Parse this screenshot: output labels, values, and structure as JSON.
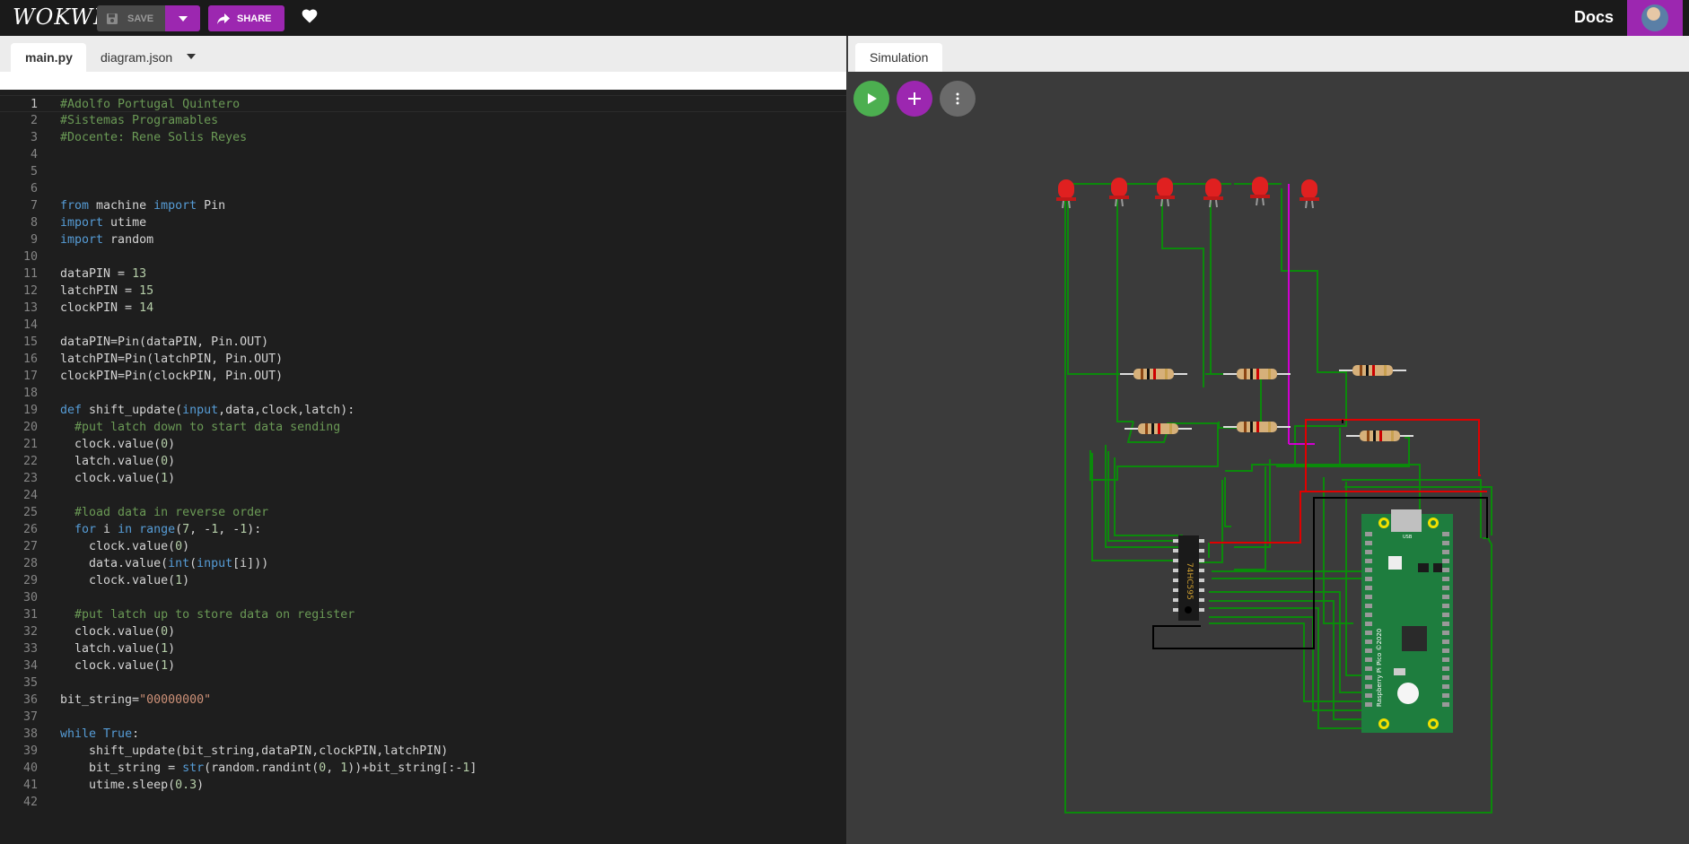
{
  "header": {
    "logo": "WOKWI",
    "save_label": "SAVE",
    "share_label": "SHARE",
    "docs_label": "Docs",
    "icons": [
      "save-icon",
      "chevron-down-icon",
      "share-arrow-icon",
      "heart-icon",
      "avatar"
    ]
  },
  "editor": {
    "tabs": [
      {
        "label": "main.py",
        "active": true
      },
      {
        "label": "diagram.json",
        "active": false
      }
    ],
    "line_numbers": [
      "1",
      "2",
      "3",
      "4",
      "5",
      "6",
      "7",
      "8",
      "9",
      "10",
      "11",
      "12",
      "13",
      "14",
      "15",
      "16",
      "17",
      "18",
      "19",
      "20",
      "21",
      "22",
      "23",
      "24",
      "25",
      "26",
      "27",
      "28",
      "29",
      "30",
      "31",
      "32",
      "33",
      "34",
      "35",
      "36",
      "37",
      "38",
      "39",
      "40",
      "41",
      "42"
    ],
    "code_lines": [
      "#Adolfo Portugal Quintero",
      "#Sistemas Programables",
      "#Docente: Rene Solis Reyes",
      "",
      "",
      "",
      "from machine import Pin",
      "import utime",
      "import random",
      "",
      "dataPIN = 13",
      "latchPIN = 15",
      "clockPIN = 14",
      "",
      "dataPIN=Pin(dataPIN, Pin.OUT)",
      "latchPIN=Pin(latchPIN, Pin.OUT)",
      "clockPIN=Pin(clockPIN, Pin.OUT)",
      "",
      "def shift_update(input,data,clock,latch):",
      "  #put latch down to start data sending",
      "  clock.value(0)",
      "  latch.value(0)",
      "  clock.value(1)",
      "",
      "  #load data in reverse order",
      "  for i in range(7, -1, -1):",
      "    clock.value(0)",
      "    data.value(int(input[i]))",
      "    clock.value(1)",
      "",
      "  #put latch up to store data on register",
      "  clock.value(0)",
      "  latch.value(1)",
      "  clock.value(1)",
      "",
      "bit_string=\"00000000\"",
      "",
      "while True:",
      "    shift_update(bit_string,dataPIN,clockPIN,latchPIN)",
      "    bit_string = str(random.randint(0, 1))+bit_string[:-1]",
      "    utime.sleep(0.3)",
      ""
    ]
  },
  "simulation": {
    "tab_label": "Simulation",
    "controls": [
      "play-icon",
      "plus-icon",
      "more-vertical-icon"
    ],
    "chip_label": "74HC595",
    "board_label": "Raspberry Pi Pico ©2020",
    "usb_label": "USB",
    "colors": {
      "accent": "#9c27b0",
      "play": "#4caf50",
      "wire_green": "#0b8a0b",
      "wire_red": "#e00000",
      "wire_magenta": "#d000d0",
      "pcb": "#1e7d3e"
    }
  }
}
